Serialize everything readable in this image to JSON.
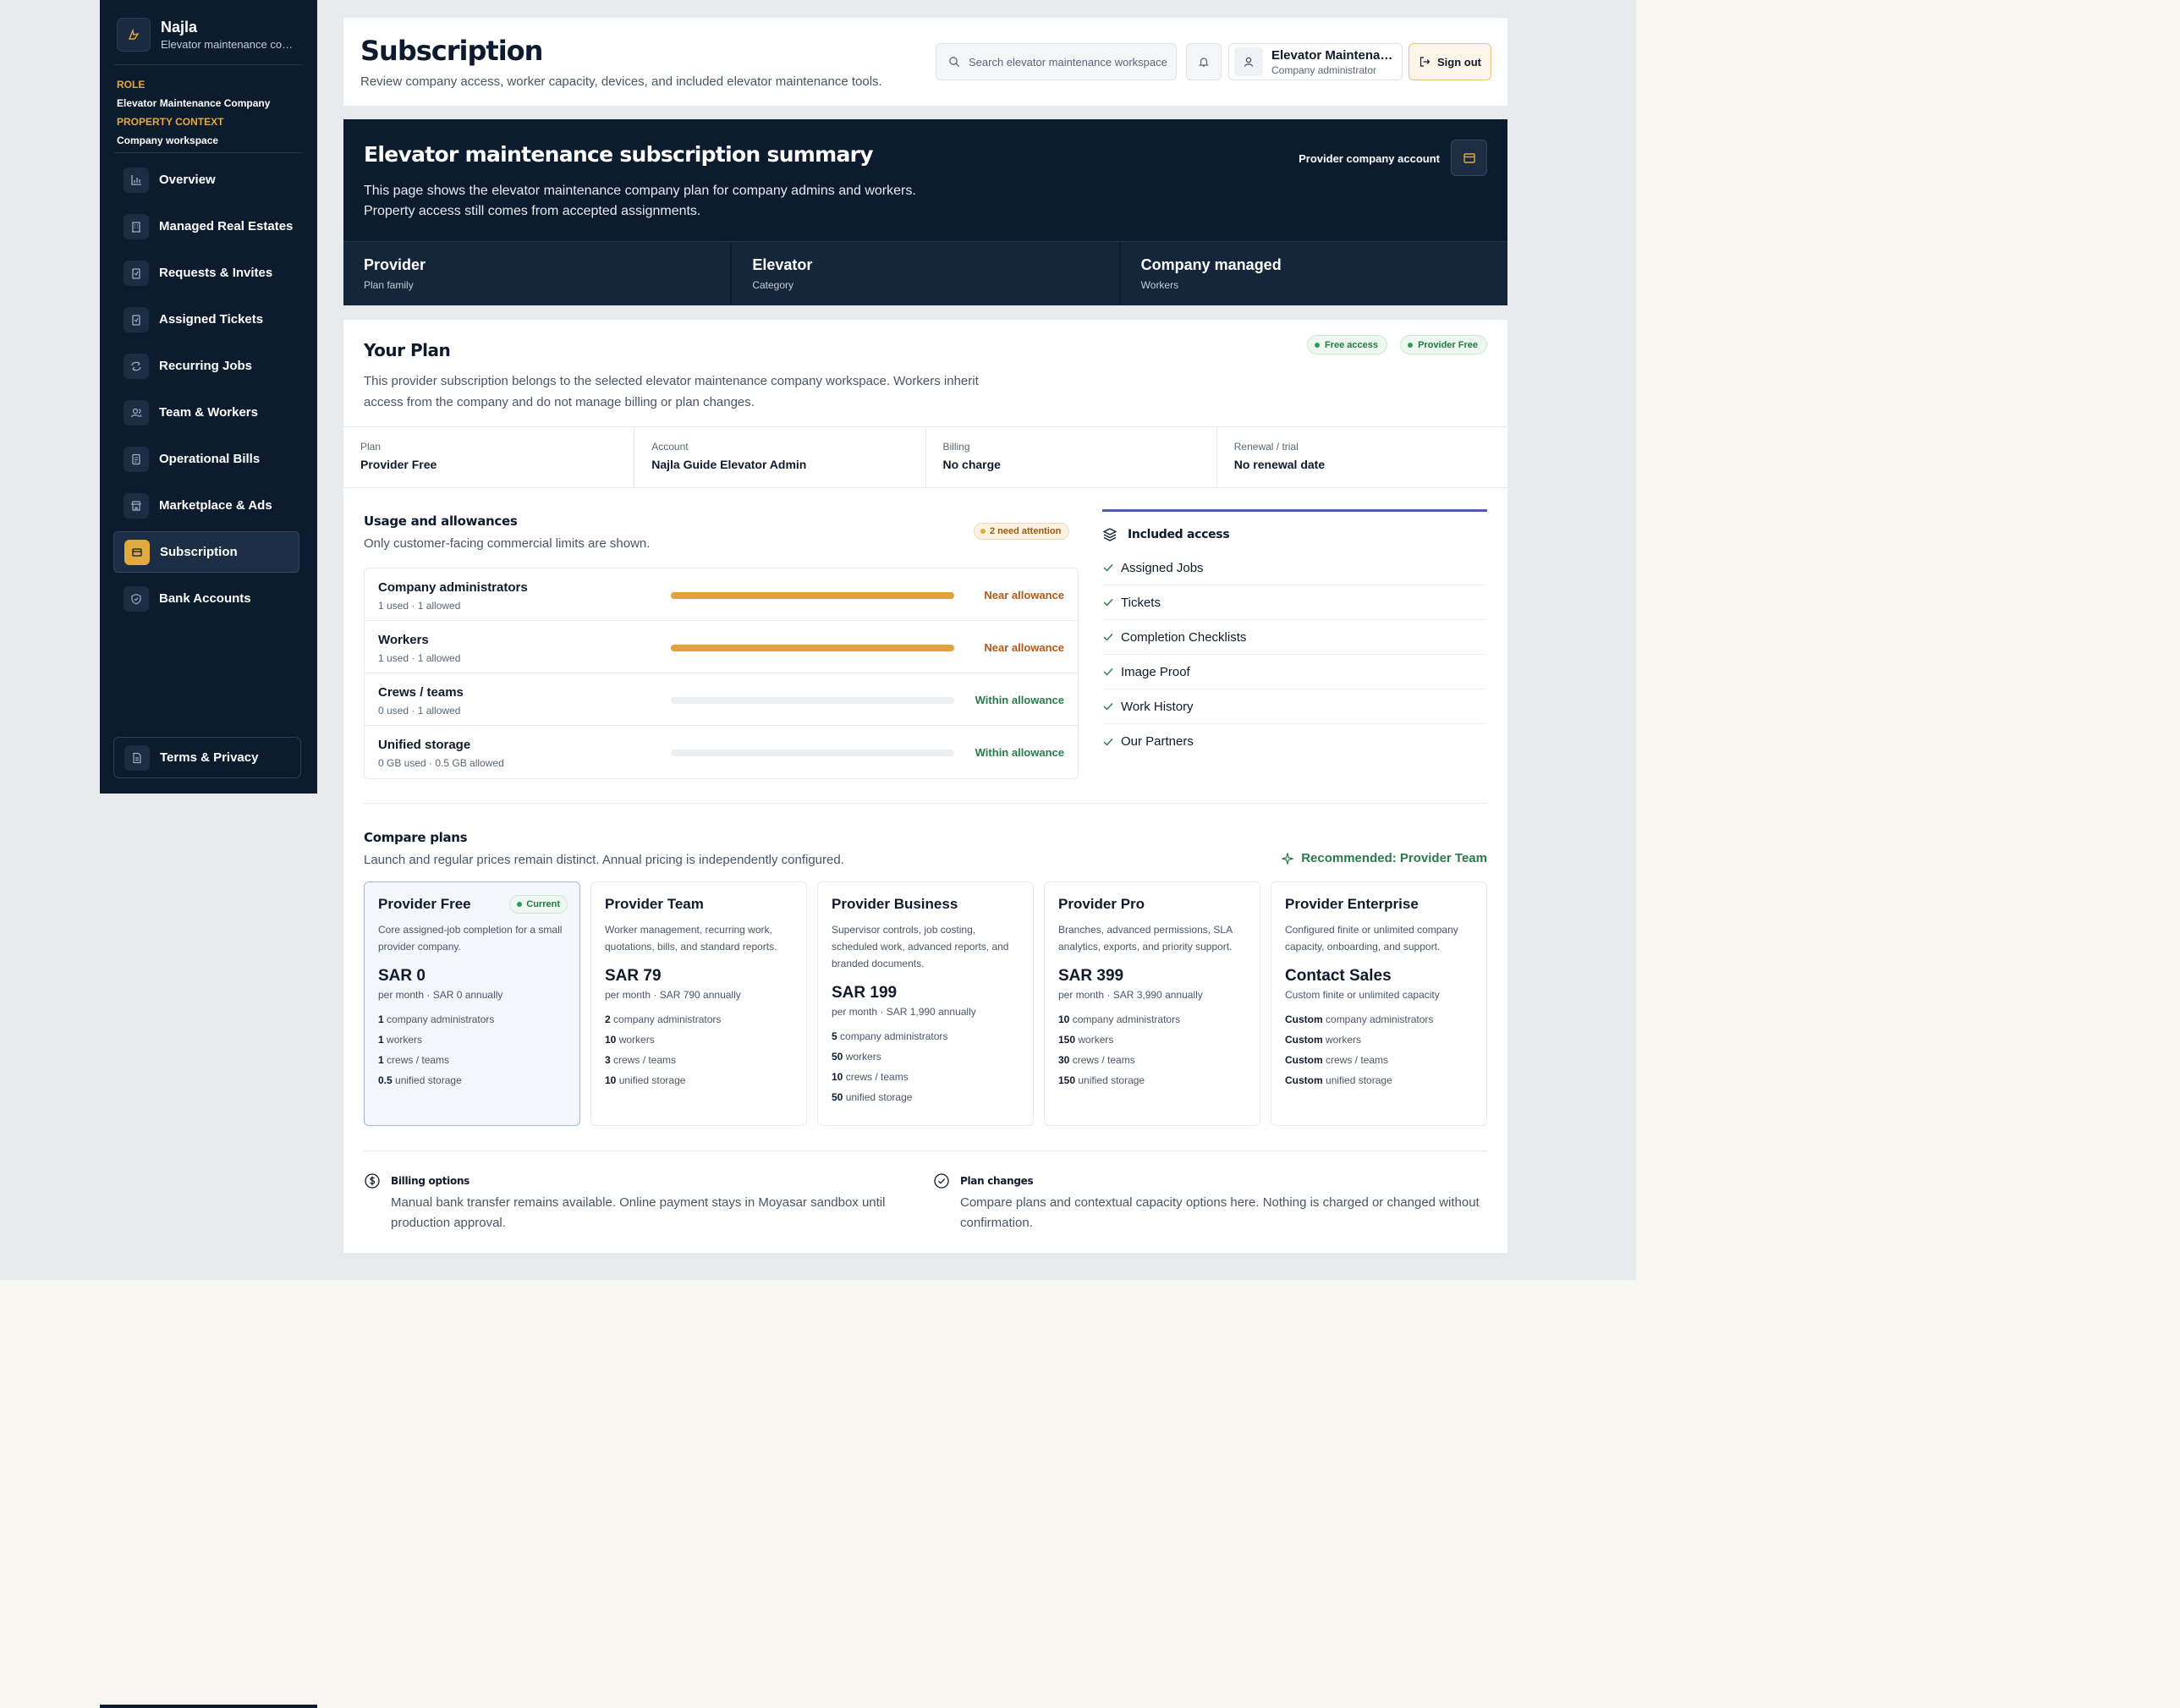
{
  "sidebar": {
    "brand_name": "Najla",
    "brand_sub": "Elevator maintenance company",
    "role_label": "ROLE",
    "role_value": "Elevator Maintenance Company",
    "context_label": "PROPERTY CONTEXT",
    "context_value": "Company workspace",
    "items": [
      {
        "label": "Overview",
        "icon": "chart-icon"
      },
      {
        "label": "Managed Real Estates",
        "icon": "building-icon"
      },
      {
        "label": "Requests & Invites",
        "icon": "clipboard-icon"
      },
      {
        "label": "Assigned Tickets",
        "icon": "clipboard-icon"
      },
      {
        "label": "Recurring Jobs",
        "icon": "repeat-icon"
      },
      {
        "label": "Team & Workers",
        "icon": "users-icon"
      },
      {
        "label": "Operational Bills",
        "icon": "receipt-icon"
      },
      {
        "label": "Marketplace & Ads",
        "icon": "store-icon"
      },
      {
        "label": "Subscription",
        "icon": "card-icon",
        "active": true
      },
      {
        "label": "Bank Accounts",
        "icon": "shield-icon"
      }
    ],
    "terms_label": "Terms & Privacy"
  },
  "header": {
    "title": "Subscription",
    "subtitle": "Review company access, worker capacity, devices, and included elevator maintenance tools.",
    "search_placeholder": "Search elevator maintenance workspace",
    "user_name": "Elevator Maintenance Company",
    "user_role": "Company administrator",
    "sign_out": "Sign out"
  },
  "summary": {
    "title": "Elevator maintenance subscription summary",
    "text_line1": "This page shows the elevator maintenance company plan for company admins and workers.",
    "text_line2": "Property access still comes from accepted assignments.",
    "account_label": "Provider company account",
    "cards": [
      {
        "title": "Provider",
        "sub": "Plan family"
      },
      {
        "title": "Elevator",
        "sub": "Category"
      },
      {
        "title": "Company managed",
        "sub": "Workers"
      }
    ]
  },
  "plan": {
    "title": "Your Plan",
    "desc": "This provider subscription belongs to the selected elevator maintenance company workspace. Workers inherit access from the company and do not manage billing or plan changes.",
    "pills": [
      "Free access",
      "Provider Free"
    ],
    "facts": [
      {
        "label": "Plan",
        "value": "Provider Free"
      },
      {
        "label": "Account",
        "value": "Najla Guide Elevator Admin"
      },
      {
        "label": "Billing",
        "value": "No charge"
      },
      {
        "label": "Renewal / trial",
        "value": "No renewal date"
      }
    ]
  },
  "usage": {
    "title": "Usage and allowances",
    "subtitle": "Only customer-facing commercial limits are shown.",
    "attention": "2 need attention",
    "rows": [
      {
        "name": "Company administrators",
        "count": "1 used · 1 allowed",
        "status": "Near allowance",
        "fill": 1.0
      },
      {
        "name": "Workers",
        "count": "1 used · 1 allowed",
        "status": "Near allowance",
        "fill": 1.0
      },
      {
        "name": "Crews / teams",
        "count": "0 used · 1 allowed",
        "status": "Within allowance",
        "fill": 0
      },
      {
        "name": "Unified storage",
        "count": "0 GB used · 0.5 GB allowed",
        "status": "Within allowance",
        "fill": 0
      }
    ]
  },
  "access": {
    "title": "Included access",
    "items": [
      "Assigned Jobs",
      "Tickets",
      "Completion Checklists",
      "Image Proof",
      "Work History",
      "Our Partners"
    ]
  },
  "compare": {
    "title": "Compare plans",
    "subtitle": "Launch and regular prices remain distinct. Annual pricing is independently configured.",
    "recommended": "Recommended: Provider Team",
    "current_badge": "Current",
    "plans": [
      {
        "name": "Provider Free",
        "desc": "Core assigned-job completion for a small provider company.",
        "price": "SAR 0",
        "period": "per month · SAR 0 annually",
        "feats": [
          [
            "1",
            "company administrators"
          ],
          [
            "1",
            "workers"
          ],
          [
            "1",
            "crews / teams"
          ],
          [
            "0.5",
            "unified storage"
          ]
        ]
      },
      {
        "name": "Provider Team",
        "desc": "Worker management, recurring work, quotations, bills, and standard reports.",
        "price": "SAR 79",
        "period": "per month · SAR 790 annually",
        "feats": [
          [
            "2",
            "company administrators"
          ],
          [
            "10",
            "workers"
          ],
          [
            "3",
            "crews / teams"
          ],
          [
            "10",
            "unified storage"
          ]
        ]
      },
      {
        "name": "Provider Business",
        "desc": "Supervisor controls, job costing, scheduled work, advanced reports, and branded documents.",
        "price": "SAR 199",
        "period": "per month · SAR 1,990 annually",
        "feats": [
          [
            "5",
            "company administrators"
          ],
          [
            "50",
            "workers"
          ],
          [
            "10",
            "crews / teams"
          ],
          [
            "50",
            "unified storage"
          ]
        ]
      },
      {
        "name": "Provider Pro",
        "desc": "Branches, advanced permissions, SLA analytics, exports, and priority support.",
        "price": "SAR 399",
        "period": "per month · SAR 3,990 annually",
        "feats": [
          [
            "10",
            "company administrators"
          ],
          [
            "150",
            "workers"
          ],
          [
            "30",
            "crews / teams"
          ],
          [
            "150",
            "unified storage"
          ]
        ]
      },
      {
        "name": "Provider Enterprise",
        "desc": "Configured finite or unlimited company capacity, onboarding, and support.",
        "price": "Contact Sales",
        "period": "Custom finite or unlimited capacity",
        "feats": [
          [
            "Custom",
            "company administrators"
          ],
          [
            "Custom",
            "workers"
          ],
          [
            "Custom",
            "crews / teams"
          ],
          [
            "Custom",
            "unified storage"
          ]
        ]
      }
    ]
  },
  "footer_info": {
    "billing_title": "Billing options",
    "billing_text": "Manual bank transfer remains available. Online payment stays in Moyasar sandbox until production approval.",
    "changes_title": "Plan changes",
    "changes_text": "Compare plans and contextual capacity options here. Nothing is charged or changed without confirmation."
  },
  "colors": {
    "navy": "#0d1b2e",
    "accent": "#e2a93c",
    "success": "#2a7a4c",
    "warning": "#b15a17"
  }
}
